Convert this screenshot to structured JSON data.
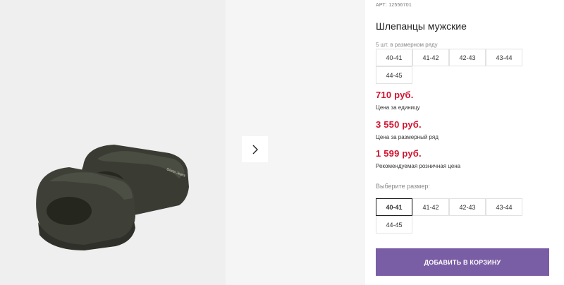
{
  "product": {
    "article": "АРТ: 12556701",
    "title": "Шлепанцы мужские",
    "pack_note": "5 шт. в размерном ряду",
    "pack_sizes": [
      "40-41",
      "41-42",
      "42-43",
      "43-44",
      "44-45"
    ],
    "prices": [
      {
        "value": "710 руб.",
        "label": "Цена за единицу"
      },
      {
        "value": "3 550 руб.",
        "label": "Цена за размерный ряд"
      },
      {
        "value": "1 599 руб.",
        "label": "Рекомендуемая розничная цена"
      }
    ],
    "choose_label": "Выберите размер:",
    "choose_sizes": [
      "40-41",
      "41-42",
      "42-43",
      "43-44",
      "44-45"
    ],
    "selected_size": "40-41",
    "image_brand": "Gloria Jeans"
  },
  "gallery": {
    "next_icon": "chevron-right-icon"
  },
  "actions": {
    "add_to_cart": "ДОБАВИТЬ В КОРЗИНУ"
  },
  "colors": {
    "price": "#d0142f",
    "button": "#7a5ea5",
    "slide": "#3e4037"
  }
}
